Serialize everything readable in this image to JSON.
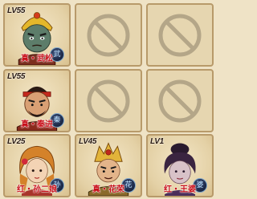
{
  "heroes": [
    {
      "level": "LV55",
      "name": "真・武松",
      "badge": "武"
    },
    {
      "level": "LV55",
      "name": "真・秦进",
      "badge": "秦"
    },
    {
      "level": "LV25",
      "name": "红・孙二娘",
      "badge": "孙"
    },
    {
      "level": "LV45",
      "name": "真・花荣",
      "badge": "花"
    },
    {
      "level": "LV1",
      "name": "红・王婆",
      "badge": "婆"
    }
  ],
  "colors": {
    "frame": "#b89a6a",
    "background": "#efe3c6",
    "name_text": "#c8101a",
    "no_sign": "#b4a688"
  },
  "icons": {
    "empty_slot": "no-entry-icon",
    "element_badge": "element-badge-icon"
  }
}
